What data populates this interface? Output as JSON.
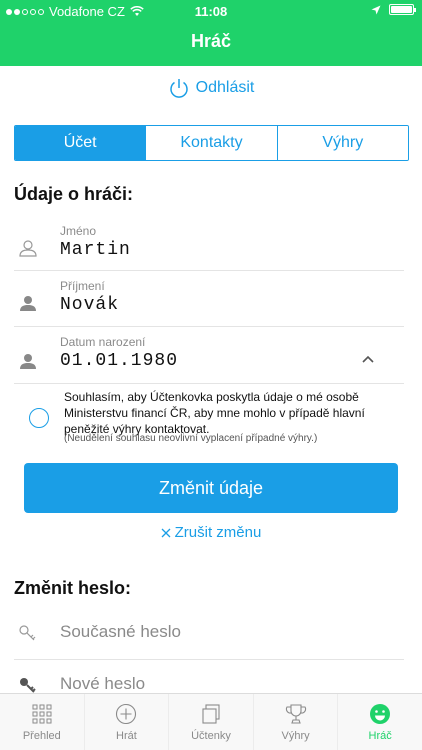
{
  "status_bar": {
    "carrier": "Vodafone CZ",
    "time": "11:08"
  },
  "header": {
    "title": "Hráč"
  },
  "logout": {
    "label": "Odhlásit"
  },
  "tabs": [
    {
      "label": "Účet",
      "active": true
    },
    {
      "label": "Kontakty",
      "active": false
    },
    {
      "label": "Výhry",
      "active": false
    }
  ],
  "player_section": {
    "title": "Údaje o hráči:",
    "first_name": {
      "label": "Jméno",
      "value": "Martin"
    },
    "last_name": {
      "label": "Příjmení",
      "value": "Novák"
    },
    "birth_date": {
      "label": "Datum narození",
      "value": "01.01.1980"
    }
  },
  "consent": {
    "text": "Souhlasím, aby Účtenkovka poskytla údaje o mé osobě Ministerstvu financí ČR, aby mne mohlo v případě hlavní peněžité výhry kontaktovat.",
    "note": "(Neudělení souhlasu neovlivní vyplacení případné výhry.)",
    "checked": false
  },
  "actions": {
    "change_label": "Změnit údaje",
    "cancel_label": "Zrušit změnu"
  },
  "password_section": {
    "title": "Změnit heslo:",
    "current_placeholder": "Současné heslo",
    "new_placeholder": "Nové heslo"
  },
  "tabbar": [
    {
      "label": "Přehled",
      "icon": "grid-icon",
      "active": false
    },
    {
      "label": "Hrát",
      "icon": "plus-circle-icon",
      "active": false
    },
    {
      "label": "Účtenky",
      "icon": "receipts-icon",
      "active": false
    },
    {
      "label": "Výhry",
      "icon": "trophy-icon",
      "active": false
    },
    {
      "label": "Hráč",
      "icon": "smiley-icon",
      "active": true
    }
  ],
  "colors": {
    "header_green": "#1fd26a",
    "accent_blue": "#1a9ee6"
  }
}
